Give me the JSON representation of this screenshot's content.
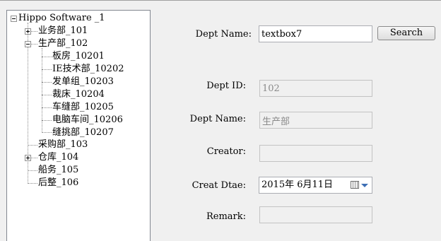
{
  "tree": {
    "root": "Hippo Software _1",
    "nodes": [
      "业务部_101",
      "生产部_102",
      "板房_10201",
      "IE技术部_10202",
      "发单组_10203",
      "裁床_10204",
      "车缝部_10205",
      "电脑车间_10206",
      "缝挑部_10207",
      "采购部_103",
      "仓库_104",
      "船务_105",
      "后整_106"
    ]
  },
  "search": {
    "label": "Dept Name:",
    "value": "textbox7",
    "button": "Search"
  },
  "form": {
    "dept_id_label": "Dept ID:",
    "dept_id_value": "102",
    "dept_name_label": "Dept Name:",
    "dept_name_value": "生产部",
    "creator_label": "Creator:",
    "creator_value": "",
    "date_label": "Creat Dtae:",
    "date_value": "2015年  6月11日",
    "remark_label": "Remark:",
    "remark_value": ""
  },
  "icons": {
    "calendar": "calendar-icon",
    "dropdown": "chevron-down-icon",
    "expand": "plus-box-icon",
    "collapse": "minus-box-icon"
  }
}
